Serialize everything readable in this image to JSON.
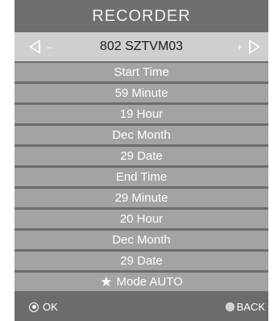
{
  "title": "RECORDER",
  "channel": {
    "name": "802 SZTVM03",
    "left_sign": "–",
    "right_sign": "+",
    "left_icon": "triangle-left-outline",
    "right_icon": "triangle-right-outline"
  },
  "rows": [
    "Start Time",
    "59 Minute",
    "19 Hour",
    "Dec Month",
    "29 Date",
    "End Time",
    "29 Minute",
    "20 Hour",
    "Dec Month",
    "29 Date"
  ],
  "mode": {
    "icon": "star",
    "label": "Mode AUTO"
  },
  "footer": {
    "ok_label": "OK",
    "ok_icon": "target-circle",
    "back_label": "BACK",
    "back_icon": "grey-dot"
  },
  "colors": {
    "panel": "#6c6c6c",
    "channel_bar": "#cfcfcf",
    "row": "#a3a3a3",
    "text": "#ffffff"
  }
}
